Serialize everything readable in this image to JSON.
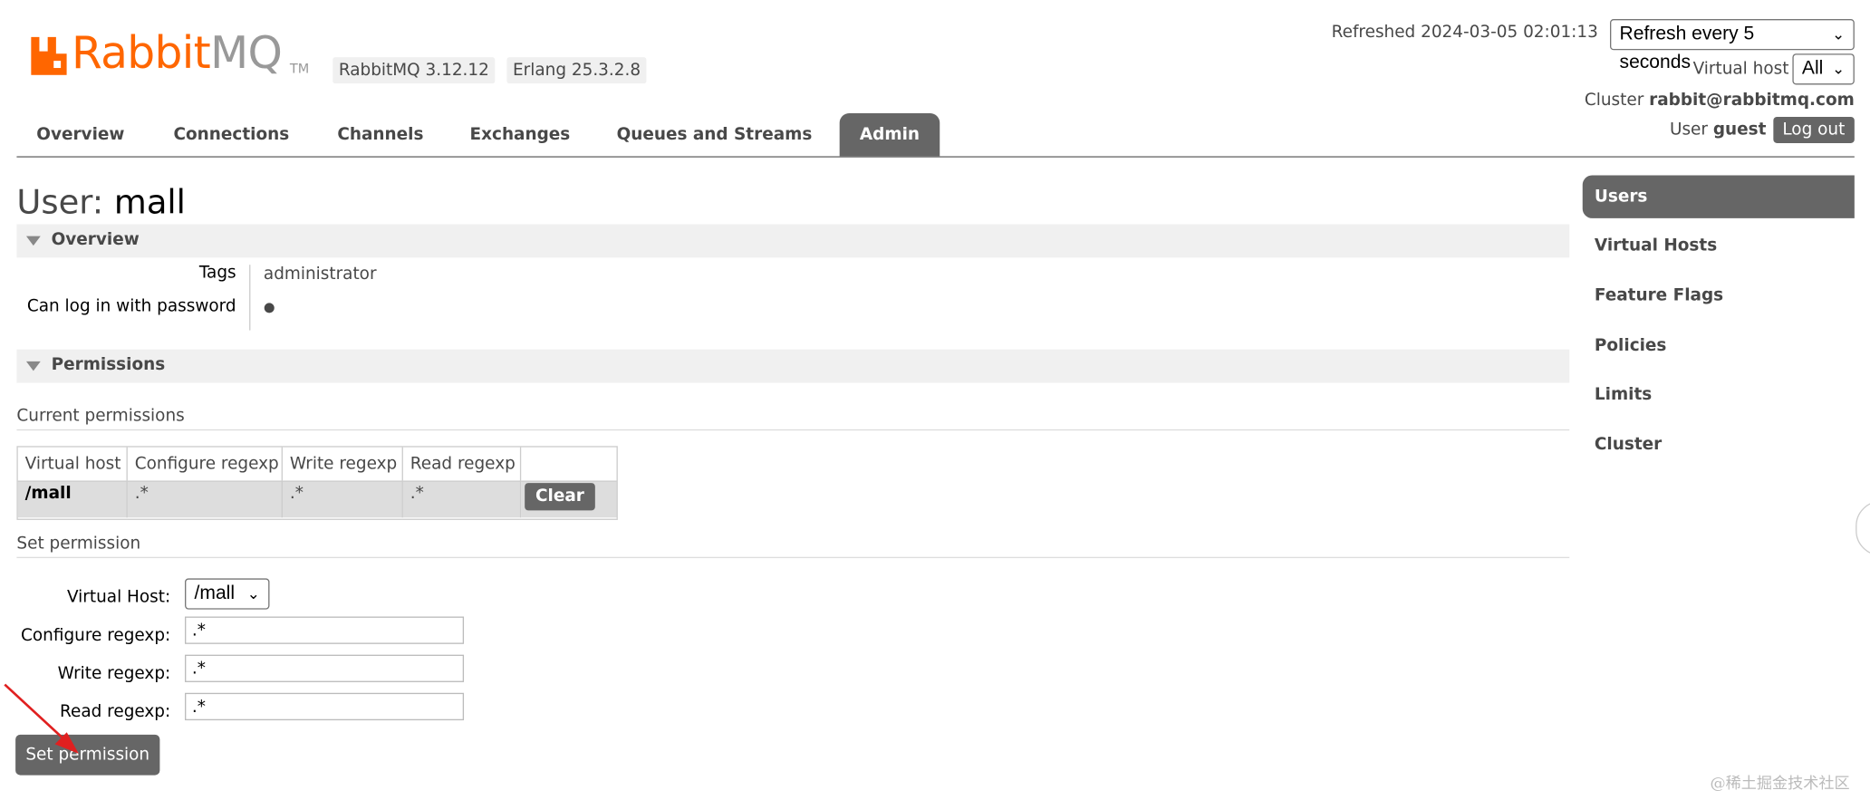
{
  "header": {
    "logo_rabbit": "Rabbit",
    "logo_mq": "MQ",
    "logo_tm": "TM",
    "rabbitmq_version": "RabbitMQ 3.12.12",
    "erlang_version": "Erlang 25.3.2.8",
    "refreshed": "Refreshed 2024-03-05 02:01:13",
    "refresh_select": "Refresh every 5 seconds",
    "virtual_host_label": "Virtual host",
    "virtual_host_select": "All",
    "cluster_label": "Cluster",
    "cluster_name": "rabbit@rabbitmq.com",
    "user_label": "User",
    "user_name": "guest",
    "logout_label": "Log out"
  },
  "nav": {
    "tabs": [
      {
        "label": "Overview"
      },
      {
        "label": "Connections"
      },
      {
        "label": "Channels"
      },
      {
        "label": "Exchanges"
      },
      {
        "label": "Queues and Streams"
      },
      {
        "label": "Admin"
      }
    ],
    "active": "Admin"
  },
  "page": {
    "title_prefix": "User:",
    "title_name": "mall"
  },
  "overview": {
    "heading": "Overview",
    "tags_label": "Tags",
    "tags_value": "administrator",
    "password_label": "Can log in with password",
    "password_value": "●"
  },
  "permissions": {
    "heading": "Permissions",
    "current_heading": "Current permissions",
    "columns": [
      "Virtual host",
      "Configure regexp",
      "Write regexp",
      "Read regexp"
    ],
    "rows": [
      {
        "vhost": "/mall",
        "configure": ".*",
        "write": ".*",
        "read": ".*"
      }
    ],
    "clear_label": "Clear",
    "set_heading": "Set permission",
    "form": {
      "vhost_label": "Virtual Host:",
      "vhost_value": "/mall",
      "configure_label": "Configure regexp:",
      "configure_value": ".*",
      "write_label": "Write regexp:",
      "write_value": ".*",
      "read_label": "Read regexp:",
      "read_value": ".*"
    },
    "submit_label": "Set permission"
  },
  "sidebar": {
    "items": [
      {
        "label": "Users"
      },
      {
        "label": "Virtual Hosts"
      },
      {
        "label": "Feature Flags"
      },
      {
        "label": "Policies"
      },
      {
        "label": "Limits"
      },
      {
        "label": "Cluster"
      }
    ],
    "active": "Users"
  },
  "watermark": "@稀土掘金技术社区",
  "colors": {
    "brand_orange": "#ff6600",
    "nav_active": "#666666",
    "arrow_red": "#e02020"
  }
}
